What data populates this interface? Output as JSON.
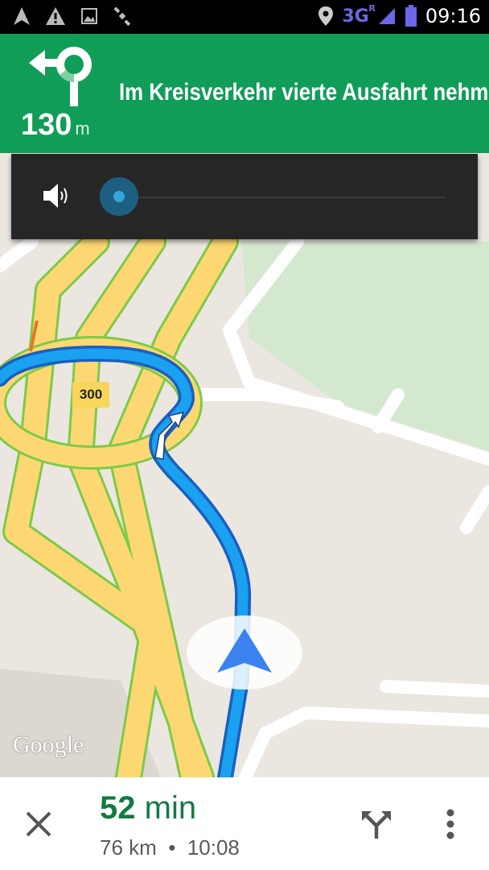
{
  "status_bar": {
    "icons": [
      "navigation-arrow-icon",
      "warning-icon",
      "image-icon",
      "satellite-icon"
    ],
    "right_icons": [
      "location-pin-icon",
      "signal-icon",
      "battery-icon"
    ],
    "network": "3G",
    "roaming": "R",
    "time": "09:16"
  },
  "navigation": {
    "maneuver_icon": "roundabout-exit-icon",
    "distance_value": "130",
    "distance_unit": "m",
    "instruction": "Im Kreisverkehr vierte Ausfahrt nehmen"
  },
  "volume_panel": {
    "icon": "speaker-icon",
    "level": 0
  },
  "map": {
    "road_badge": "300",
    "attribution": "Google",
    "colors": {
      "background": "#ebe7e0",
      "park": "#d4e8cf",
      "highway": "#fdd872",
      "highway_border": "#7ec94a",
      "route": "#1aa1f0",
      "route_border": "#1a5fc0",
      "position_arrow": "#3b82f0"
    }
  },
  "bottom_bar": {
    "close_icon": "close-icon",
    "eta_number": "52",
    "eta_unit": "min",
    "distance": "76 km",
    "separator": "•",
    "arrival_time": "10:08",
    "alternate_routes_icon": "alternate-routes-icon",
    "menu_icon": "more-vert-icon"
  },
  "accent_color": "#109d58"
}
